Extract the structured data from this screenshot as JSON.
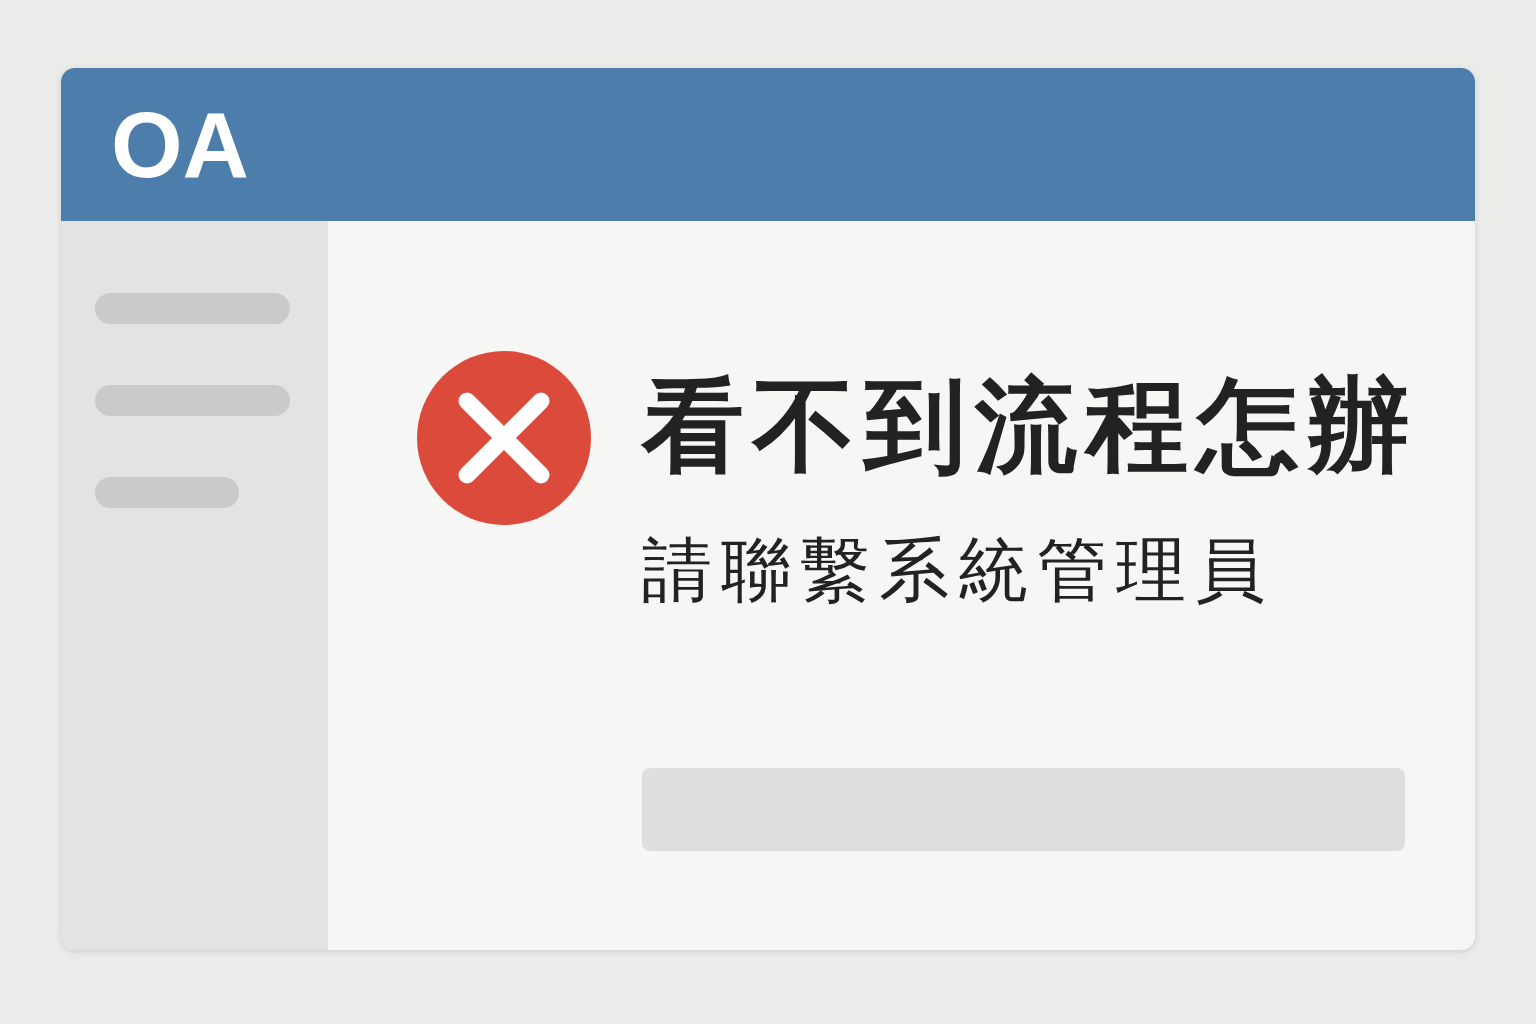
{
  "header": {
    "logo": "OA"
  },
  "message": {
    "title": "看不到流程怎辦",
    "subtitle": "請聯繫系統管理員"
  }
}
